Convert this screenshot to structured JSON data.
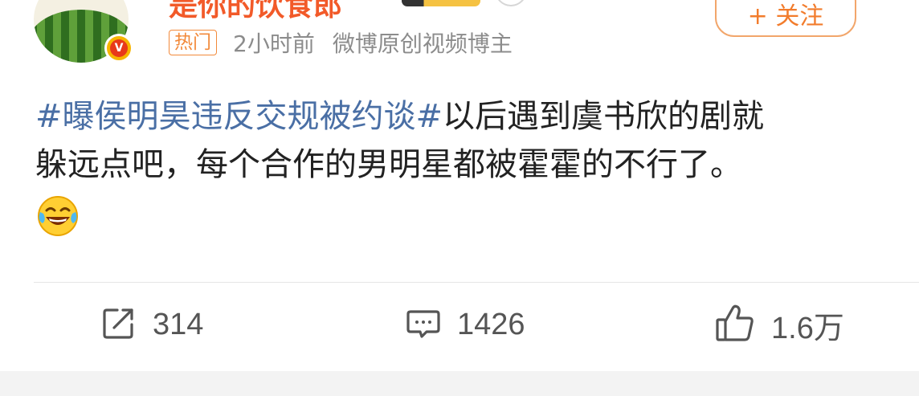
{
  "header": {
    "username": "是你的饮食郎",
    "hot_tag": "热门",
    "time": "2小时前",
    "source": "微博原创视频博主",
    "follow_label": "+ 关注",
    "verified_badge": "V"
  },
  "post": {
    "hashtag": "#曝侯明昊违反交规被约谈#",
    "text_line1": "以后遇到虞书欣的剧就",
    "text_line2": "躲远点吧，每个合作的男明星都被霍霍的不行了。",
    "emoji": "laugh-cry-emoji"
  },
  "actions": {
    "repost_count": "314",
    "comment_count": "1426",
    "like_count": "1.6万"
  },
  "colors": {
    "username": "#f25a29",
    "hashtag": "#4a6fa5",
    "hot_tag": "#f28a3b",
    "meta": "#8c8c8c",
    "follow": "#f27c2c",
    "action_text": "#555555"
  }
}
